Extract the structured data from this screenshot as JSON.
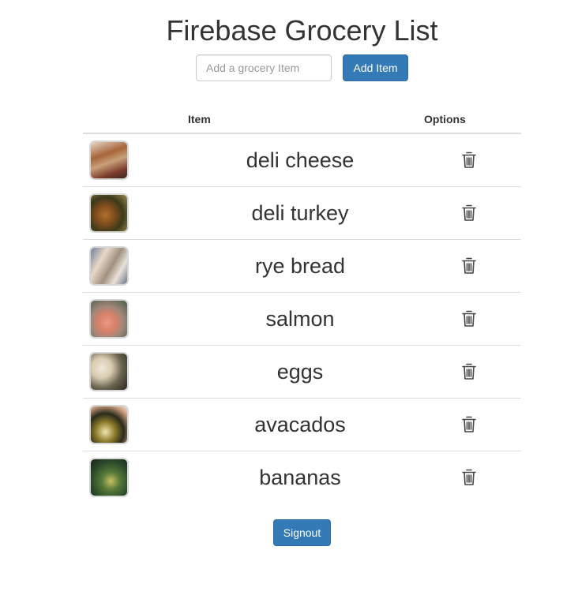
{
  "header": {
    "title": "Firebase Grocery List"
  },
  "add_form": {
    "placeholder": "Add a grocery Item",
    "value": "",
    "button_label": "Add Item"
  },
  "table": {
    "columns": [
      "Item",
      "Options"
    ],
    "rows": [
      {
        "name": "deli cheese",
        "delete_icon": "trash-icon"
      },
      {
        "name": "deli turkey",
        "delete_icon": "trash-icon"
      },
      {
        "name": "rye bread",
        "delete_icon": "trash-icon"
      },
      {
        "name": "salmon",
        "delete_icon": "trash-icon"
      },
      {
        "name": "eggs",
        "delete_icon": "trash-icon"
      },
      {
        "name": "avacados",
        "delete_icon": "trash-icon"
      },
      {
        "name": "bananas",
        "delete_icon": "trash-icon"
      }
    ]
  },
  "footer": {
    "signout_label": "Signout"
  },
  "colors": {
    "primary": "#337ab7",
    "border": "#dddddd",
    "text": "#333333"
  }
}
